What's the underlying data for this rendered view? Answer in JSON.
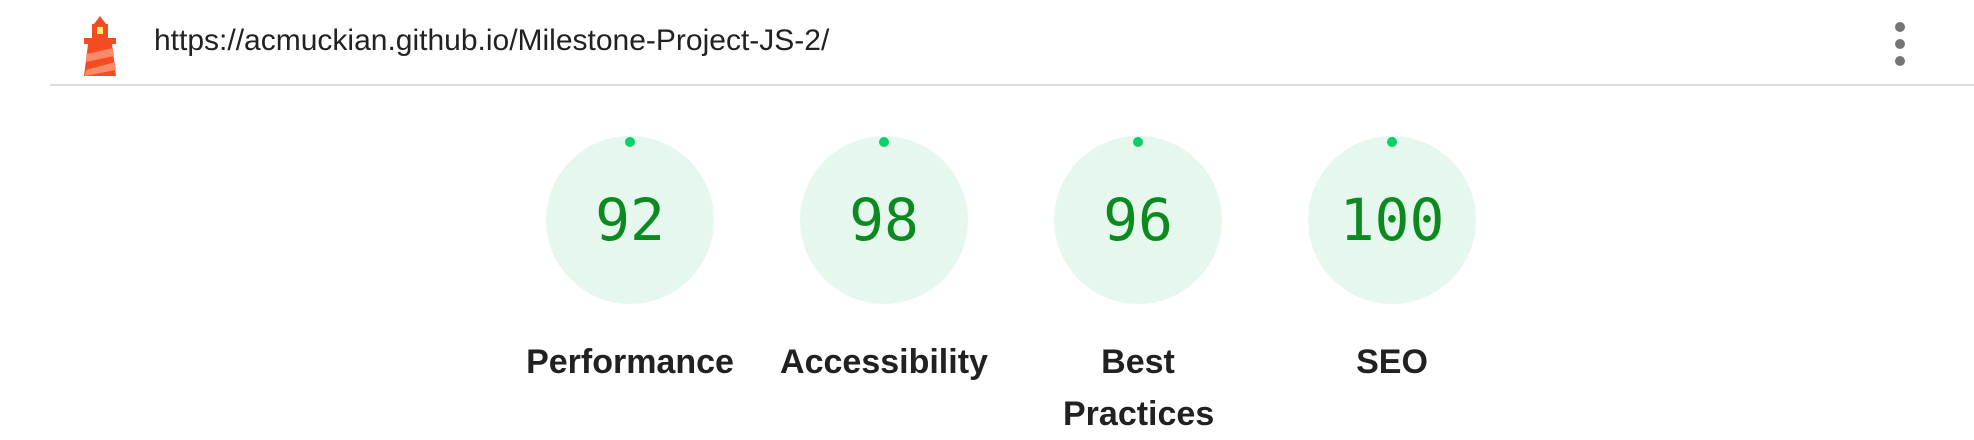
{
  "header": {
    "logo": "lighthouse-logo",
    "url": "https://acmuckian.github.io/Milestone-Project-JS-2/",
    "menu_icon": "more-vertical-icon"
  },
  "colors": {
    "pass_text": "#0c8a1f",
    "pass_ring": "#0cce6b",
    "pass_fill": "#e6f7ee"
  },
  "gauges": [
    {
      "label": "Performance",
      "score": "92"
    },
    {
      "label": "Accessibility",
      "score": "98"
    },
    {
      "label": "Best Practices",
      "score": "96"
    },
    {
      "label": "SEO",
      "score": "100"
    }
  ]
}
